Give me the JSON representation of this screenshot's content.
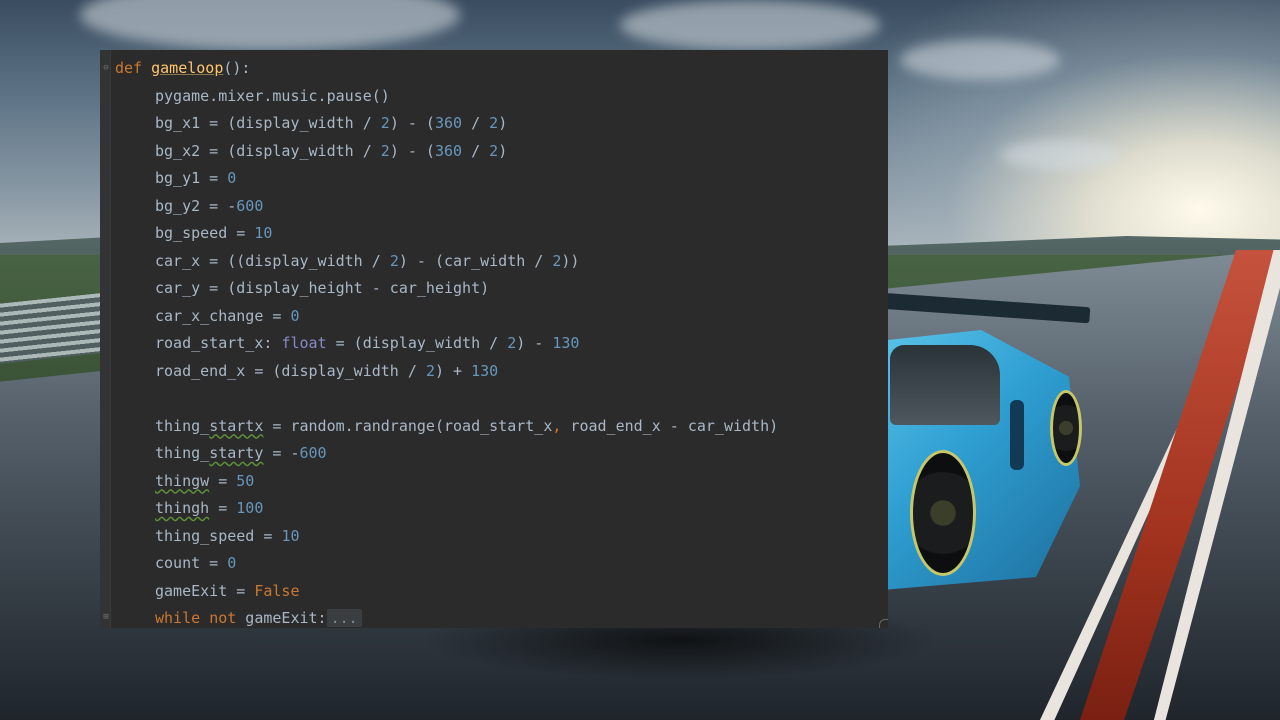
{
  "colors": {
    "editor_bg": "#2b2b2b",
    "text": "#a9b7c6",
    "keyword": "#cc7832",
    "number": "#6897bb",
    "function": "#ffc66d",
    "builtin_type": "#8888c6"
  },
  "icons": {
    "fold_start": "fold-minus-icon",
    "fold_collapsed": "fold-plus-icon"
  },
  "code": {
    "l1": {
      "kw": "def",
      "fn": "gameloop",
      "rest": "():"
    },
    "l2": {
      "text": "pygame.mixer.music.pause()"
    },
    "l3": {
      "a": "bg_x1 = (display_width / ",
      "n1": "2",
      "b": ") - (",
      "n2": "360",
      "c": " / ",
      "n3": "2",
      "d": ")"
    },
    "l4": {
      "a": "bg_x2 = (display_width / ",
      "n1": "2",
      "b": ") - (",
      "n2": "360",
      "c": " / ",
      "n3": "2",
      "d": ")"
    },
    "l5": {
      "a": "bg_y1 = ",
      "n1": "0"
    },
    "l6": {
      "a": "bg_y2 = -",
      "n1": "600"
    },
    "l7": {
      "a": "bg_speed = ",
      "n1": "10"
    },
    "l8": {
      "a": "car_x = ((display_width / ",
      "n1": "2",
      "b": ") - (car_width / ",
      "n2": "2",
      "c": "))"
    },
    "l9": {
      "text": "car_y = (display_height - car_height)"
    },
    "l10": {
      "a": "car_x_change = ",
      "n1": "0"
    },
    "l11": {
      "a": "road_start_x: ",
      "typ": "float",
      "b": " = (display_width / ",
      "n1": "2",
      "c": ") - ",
      "n2": "130"
    },
    "l12": {
      "a": "road_end_x = (display_width / ",
      "n1": "2",
      "b": ") + ",
      "n2": "130"
    },
    "l14": {
      "a1": "thing_",
      "w1": "startx",
      "a2": " = random.randrange(road_start_x",
      "comma": ",",
      "a3": " road_end_x - car_width)"
    },
    "l15": {
      "a1": "thing_",
      "w1": "starty",
      "a2": " = -",
      "n1": "600"
    },
    "l16": {
      "w1": "thingw",
      "a": " = ",
      "n1": "50"
    },
    "l17": {
      "w1": "thingh",
      "a": " = ",
      "n1": "100"
    },
    "l18": {
      "a": "thing_speed = ",
      "n1": "10"
    },
    "l19": {
      "a": "count = ",
      "n1": "0"
    },
    "l20": {
      "a": "gameExit = ",
      "kw": "False"
    },
    "l21": {
      "kw1": "while",
      "kw2": "not",
      "a": " gameExit:",
      "collapsed": "..."
    }
  }
}
